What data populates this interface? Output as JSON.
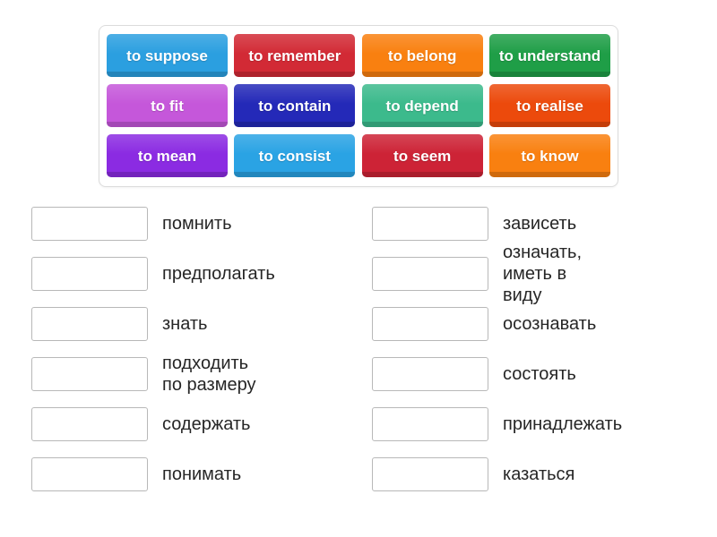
{
  "tile_bank": {
    "rows": [
      [
        {
          "label": "to suppose",
          "color": "#2b9fe0"
        },
        {
          "label": "to remember",
          "color": "#d22a35"
        },
        {
          "label": "to belong",
          "color": "#f98010"
        },
        {
          "label": "to understand",
          "color": "#1f9e47"
        }
      ],
      [
        {
          "label": "to fit",
          "color": "#c557da"
        },
        {
          "label": "to contain",
          "color": "#2429b8"
        },
        {
          "label": "to depend",
          "color": "#3cba8c"
        },
        {
          "label": "to realise",
          "color": "#ec4a0c"
        }
      ],
      [
        {
          "label": "to mean",
          "color": "#8b2be2"
        },
        {
          "label": "to consist",
          "color": "#2aa3e4"
        },
        {
          "label": "to seem",
          "color": "#cd2336"
        },
        {
          "label": "to know",
          "color": "#f98010"
        }
      ]
    ]
  },
  "answers": {
    "left_column": [
      {
        "box_value": "",
        "label": "помнить"
      },
      {
        "box_value": "",
        "label": "предполагать"
      },
      {
        "box_value": "",
        "label": "знать"
      },
      {
        "box_value": "",
        "label": "подходить\nпо размеру"
      },
      {
        "box_value": "",
        "label": "содержать"
      },
      {
        "box_value": "",
        "label": "понимать"
      }
    ],
    "right_column": [
      {
        "box_value": "",
        "label": "зависеть"
      },
      {
        "box_value": "",
        "label": "означать,\nиметь в виду"
      },
      {
        "box_value": "",
        "label": "осознавать"
      },
      {
        "box_value": "",
        "label": "состоять"
      },
      {
        "box_value": "",
        "label": "принадлежать"
      },
      {
        "box_value": "",
        "label": "казаться"
      }
    ]
  }
}
